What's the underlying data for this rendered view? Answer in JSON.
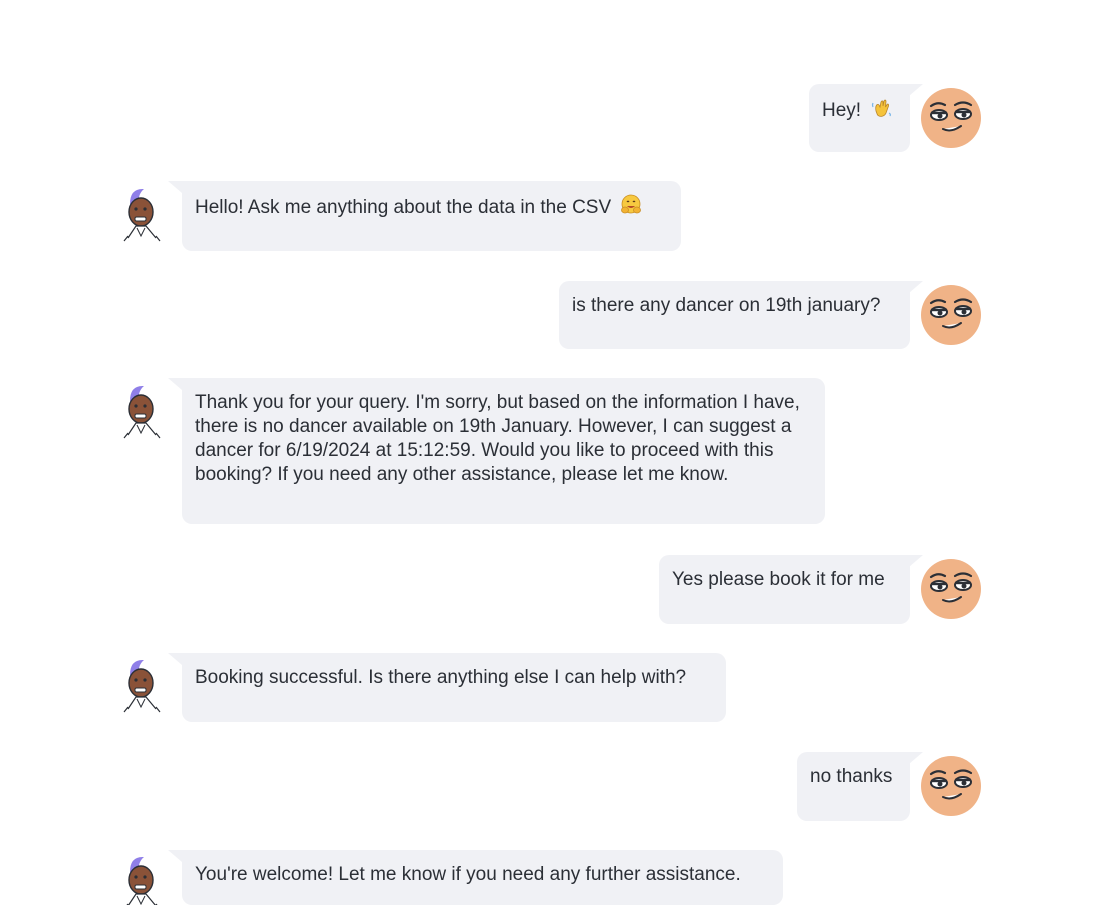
{
  "conversation": {
    "messages": [
      {
        "role": "user",
        "text": "Hey!",
        "emoji": "waving-hand-icon"
      },
      {
        "role": "assistant",
        "text": "Hello! Ask me anything about the data in the CSV",
        "emoji": "hugging-face-icon"
      },
      {
        "role": "user",
        "text": "is there any dancer on 19th january?"
      },
      {
        "role": "assistant",
        "text": "Thank you for your query. I'm sorry, but based on the information I have, there is no dancer available on 19th January. However, I can suggest a dancer for 6/19/2024 at 15:12:59. Would you like to proceed with this booking? If you need any other assistance, please let me know."
      },
      {
        "role": "user",
        "text": "Yes please book it for me"
      },
      {
        "role": "assistant",
        "text": "Booking successful. Is there anything else I can help with?"
      },
      {
        "role": "user",
        "text": "no thanks"
      },
      {
        "role": "assistant",
        "text": "You're welcome! Let me know if you need any further assistance."
      }
    ]
  },
  "colors": {
    "bubble_background": "#f0f1f5",
    "text": "#2b2f36",
    "user_avatar_skin": "#f0b387",
    "bot_avatar_hair": "#8f7fe8",
    "bot_avatar_skin": "#8a5238"
  }
}
